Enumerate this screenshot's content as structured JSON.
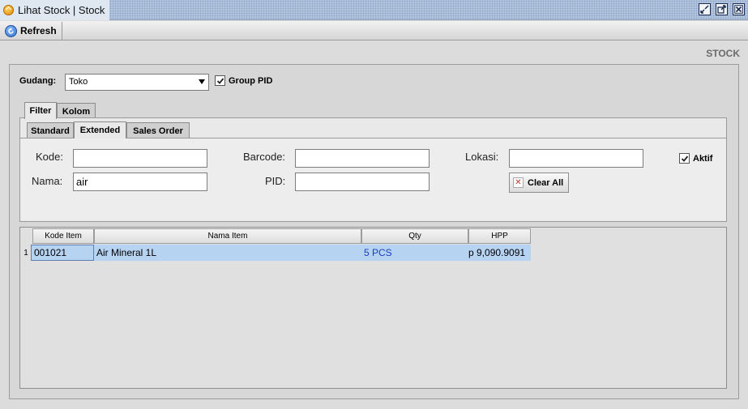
{
  "window": {
    "title": "Lihat Stock | Stock"
  },
  "toolbar": {
    "refresh_label": "Refresh"
  },
  "section_label": "STOCK",
  "gudang": {
    "label": "Gudang:",
    "selected": "Toko",
    "group_pid_label": "Group PID",
    "group_pid_checked": true
  },
  "outer_tabs": [
    {
      "label": "Filter",
      "active": true
    },
    {
      "label": "Kolom",
      "active": false
    }
  ],
  "inner_tabs": [
    {
      "label": "Standard",
      "active": false
    },
    {
      "label": "Extended",
      "active": true
    },
    {
      "label": "Sales Order",
      "active": false
    }
  ],
  "filter": {
    "kode_label": "Kode:",
    "kode_value": "",
    "nama_label": "Nama:",
    "nama_value": "air",
    "barcode_label": "Barcode:",
    "barcode_value": "",
    "pid_label": "PID:",
    "pid_value": "",
    "lokasi_label": "Lokasi:",
    "lokasi_value": "",
    "clear_all_label": "Clear All",
    "aktif_label": "Aktif",
    "aktif_checked": true
  },
  "table": {
    "columns": [
      "Kode Item",
      "Nama Item",
      "Qty",
      "HPP"
    ],
    "rows": [
      {
        "num": "1",
        "kode": "001021",
        "nama": "Air Mineral 1L",
        "qty": "5 PCS",
        "hpp": "p 9,090.9091"
      }
    ]
  },
  "colors": {
    "selection": "#b6d3f2",
    "qty_text": "#1a3cc4"
  }
}
